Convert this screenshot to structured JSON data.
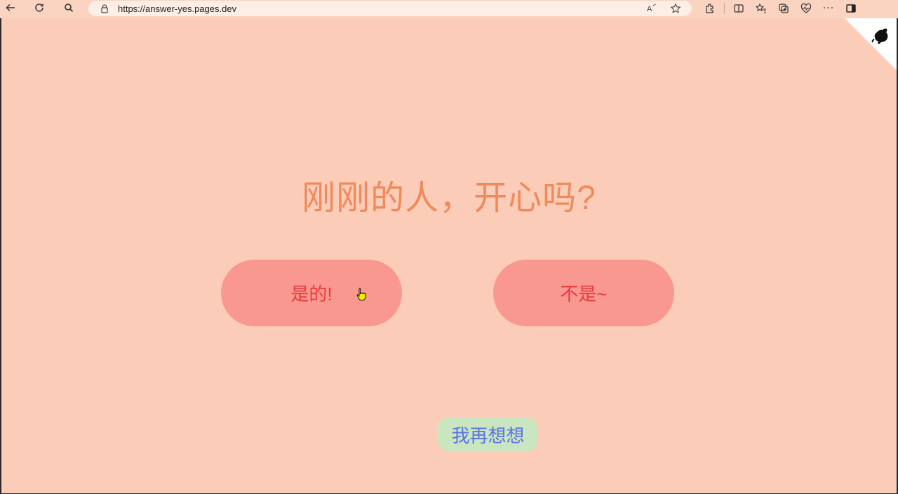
{
  "browser": {
    "url": "https://answer-yes.pages.dev",
    "read_aloud_label": "A̅"
  },
  "page": {
    "question": "刚刚的人，开心吗?",
    "yes_label": "是的!",
    "no_label": "不是~",
    "think_label": "我再想想"
  },
  "colors": {
    "background": "#fbcdb8",
    "question": "#f08a5c",
    "pill": "#f99890",
    "pill_text": "#e63b3b",
    "think_bg": "#c9e6c0",
    "think_text": "#5a72e6"
  }
}
